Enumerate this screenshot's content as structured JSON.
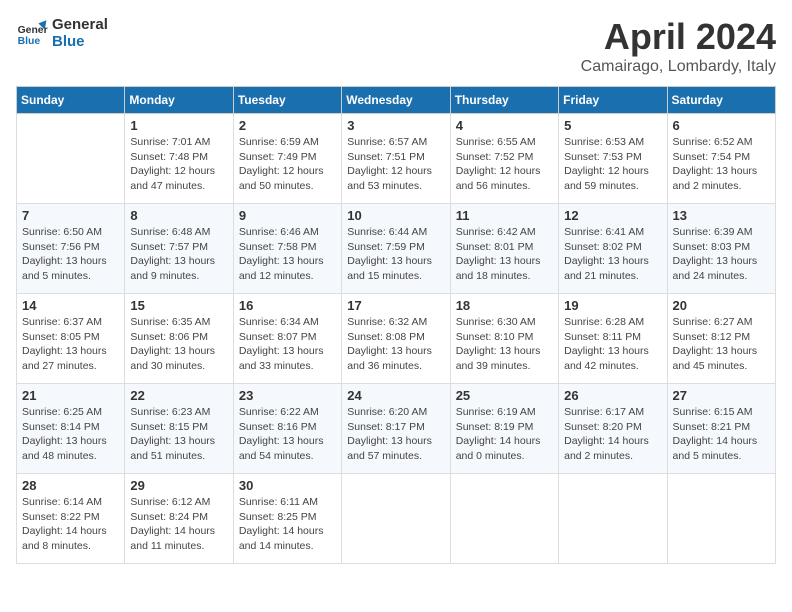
{
  "header": {
    "logo_line1": "General",
    "logo_line2": "Blue",
    "month": "April 2024",
    "location": "Camairago, Lombardy, Italy"
  },
  "weekdays": [
    "Sunday",
    "Monday",
    "Tuesday",
    "Wednesday",
    "Thursday",
    "Friday",
    "Saturday"
  ],
  "weeks": [
    [
      {
        "day": "",
        "info": ""
      },
      {
        "day": "1",
        "info": "Sunrise: 7:01 AM\nSunset: 7:48 PM\nDaylight: 12 hours\nand 47 minutes."
      },
      {
        "day": "2",
        "info": "Sunrise: 6:59 AM\nSunset: 7:49 PM\nDaylight: 12 hours\nand 50 minutes."
      },
      {
        "day": "3",
        "info": "Sunrise: 6:57 AM\nSunset: 7:51 PM\nDaylight: 12 hours\nand 53 minutes."
      },
      {
        "day": "4",
        "info": "Sunrise: 6:55 AM\nSunset: 7:52 PM\nDaylight: 12 hours\nand 56 minutes."
      },
      {
        "day": "5",
        "info": "Sunrise: 6:53 AM\nSunset: 7:53 PM\nDaylight: 12 hours\nand 59 minutes."
      },
      {
        "day": "6",
        "info": "Sunrise: 6:52 AM\nSunset: 7:54 PM\nDaylight: 13 hours\nand 2 minutes."
      }
    ],
    [
      {
        "day": "7",
        "info": "Sunrise: 6:50 AM\nSunset: 7:56 PM\nDaylight: 13 hours\nand 5 minutes."
      },
      {
        "day": "8",
        "info": "Sunrise: 6:48 AM\nSunset: 7:57 PM\nDaylight: 13 hours\nand 9 minutes."
      },
      {
        "day": "9",
        "info": "Sunrise: 6:46 AM\nSunset: 7:58 PM\nDaylight: 13 hours\nand 12 minutes."
      },
      {
        "day": "10",
        "info": "Sunrise: 6:44 AM\nSunset: 7:59 PM\nDaylight: 13 hours\nand 15 minutes."
      },
      {
        "day": "11",
        "info": "Sunrise: 6:42 AM\nSunset: 8:01 PM\nDaylight: 13 hours\nand 18 minutes."
      },
      {
        "day": "12",
        "info": "Sunrise: 6:41 AM\nSunset: 8:02 PM\nDaylight: 13 hours\nand 21 minutes."
      },
      {
        "day": "13",
        "info": "Sunrise: 6:39 AM\nSunset: 8:03 PM\nDaylight: 13 hours\nand 24 minutes."
      }
    ],
    [
      {
        "day": "14",
        "info": "Sunrise: 6:37 AM\nSunset: 8:05 PM\nDaylight: 13 hours\nand 27 minutes."
      },
      {
        "day": "15",
        "info": "Sunrise: 6:35 AM\nSunset: 8:06 PM\nDaylight: 13 hours\nand 30 minutes."
      },
      {
        "day": "16",
        "info": "Sunrise: 6:34 AM\nSunset: 8:07 PM\nDaylight: 13 hours\nand 33 minutes."
      },
      {
        "day": "17",
        "info": "Sunrise: 6:32 AM\nSunset: 8:08 PM\nDaylight: 13 hours\nand 36 minutes."
      },
      {
        "day": "18",
        "info": "Sunrise: 6:30 AM\nSunset: 8:10 PM\nDaylight: 13 hours\nand 39 minutes."
      },
      {
        "day": "19",
        "info": "Sunrise: 6:28 AM\nSunset: 8:11 PM\nDaylight: 13 hours\nand 42 minutes."
      },
      {
        "day": "20",
        "info": "Sunrise: 6:27 AM\nSunset: 8:12 PM\nDaylight: 13 hours\nand 45 minutes."
      }
    ],
    [
      {
        "day": "21",
        "info": "Sunrise: 6:25 AM\nSunset: 8:14 PM\nDaylight: 13 hours\nand 48 minutes."
      },
      {
        "day": "22",
        "info": "Sunrise: 6:23 AM\nSunset: 8:15 PM\nDaylight: 13 hours\nand 51 minutes."
      },
      {
        "day": "23",
        "info": "Sunrise: 6:22 AM\nSunset: 8:16 PM\nDaylight: 13 hours\nand 54 minutes."
      },
      {
        "day": "24",
        "info": "Sunrise: 6:20 AM\nSunset: 8:17 PM\nDaylight: 13 hours\nand 57 minutes."
      },
      {
        "day": "25",
        "info": "Sunrise: 6:19 AM\nSunset: 8:19 PM\nDaylight: 14 hours\nand 0 minutes."
      },
      {
        "day": "26",
        "info": "Sunrise: 6:17 AM\nSunset: 8:20 PM\nDaylight: 14 hours\nand 2 minutes."
      },
      {
        "day": "27",
        "info": "Sunrise: 6:15 AM\nSunset: 8:21 PM\nDaylight: 14 hours\nand 5 minutes."
      }
    ],
    [
      {
        "day": "28",
        "info": "Sunrise: 6:14 AM\nSunset: 8:22 PM\nDaylight: 14 hours\nand 8 minutes."
      },
      {
        "day": "29",
        "info": "Sunrise: 6:12 AM\nSunset: 8:24 PM\nDaylight: 14 hours\nand 11 minutes."
      },
      {
        "day": "30",
        "info": "Sunrise: 6:11 AM\nSunset: 8:25 PM\nDaylight: 14 hours\nand 14 minutes."
      },
      {
        "day": "",
        "info": ""
      },
      {
        "day": "",
        "info": ""
      },
      {
        "day": "",
        "info": ""
      },
      {
        "day": "",
        "info": ""
      }
    ]
  ]
}
